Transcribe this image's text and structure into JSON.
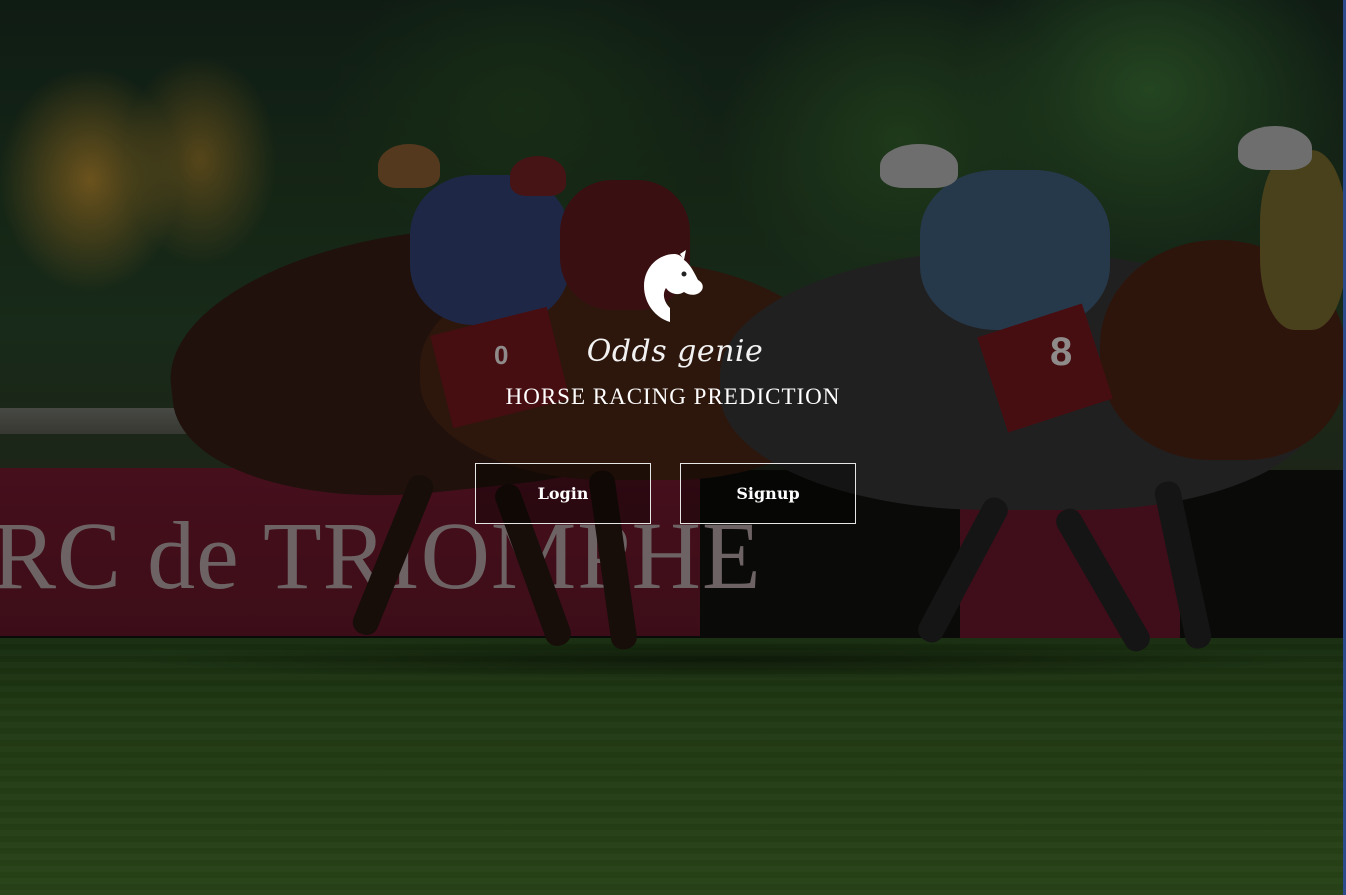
{
  "brand": {
    "script_name": "Odds genie",
    "tagline": "HORSE RACING PREDICTION",
    "logo_icon": "horse-head-icon"
  },
  "actions": {
    "login_label": "Login",
    "signup_label": "Signup"
  },
  "background": {
    "banner_text": "RC de TRIOMPHE",
    "saddle_numbers": [
      "0",
      "8"
    ]
  },
  "colors": {
    "text": "#ffffff",
    "button_border": "#e6e6e6",
    "banner": "#5a1424"
  }
}
